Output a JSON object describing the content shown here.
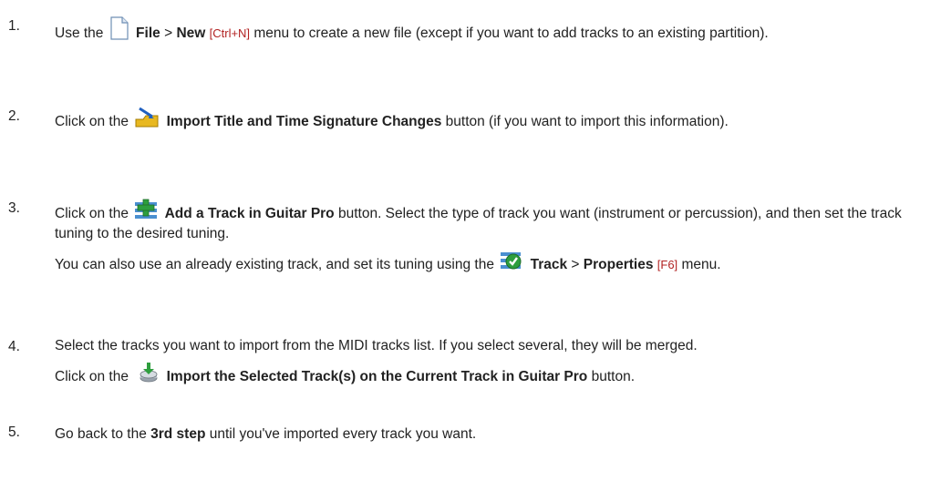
{
  "steps": [
    {
      "number": "1.",
      "lines": [
        {
          "pre": "Use the",
          "b1": "File",
          "sep": ">",
          "b2": "New",
          "shortcut": "[Ctrl+N]",
          "post": "menu to create a new file (except if you want to add tracks to an existing partition)."
        }
      ],
      "icon": "blank-file-icon"
    },
    {
      "number": "2.",
      "pre": "Click on the",
      "bold": "Import Title and Time Signature Changes",
      "post": "button (if you want to import this information).",
      "icon": "import-title-icon"
    },
    {
      "number": "3.",
      "pre": "Click on the",
      "bold": "Add a Track in Guitar Pro",
      "post": "button. Select the type of track you want (instrument or percussion), and then set the track tuning to the desired tuning.",
      "icon": "add-track-icon",
      "second": {
        "pre": "You can also use an already existing track, and set its tuning using the",
        "b1": "Track",
        "sep": ">",
        "b2": "Properties",
        "shortcut": "[F6]",
        "post": "menu.",
        "icon": "track-properties-icon"
      }
    },
    {
      "number": "4.",
      "line1": "Select the tracks you want to import from the MIDI tracks list. If you select several, they will be merged.",
      "pre": "Click on the",
      "bold": "Import the Selected Track(s) on the Current Track in Guitar Pro",
      "post": "button.",
      "icon": "import-selected-tracks-icon"
    },
    {
      "number": "5.",
      "pre": "Go back to the",
      "bold": "3rd step",
      "post": "until you've imported every track you want."
    }
  ],
  "colors": {
    "text": "#222222",
    "shortcut": "#b22222",
    "accent_green": "#2e9e3e",
    "accent_yellow": "#e8b820"
  }
}
